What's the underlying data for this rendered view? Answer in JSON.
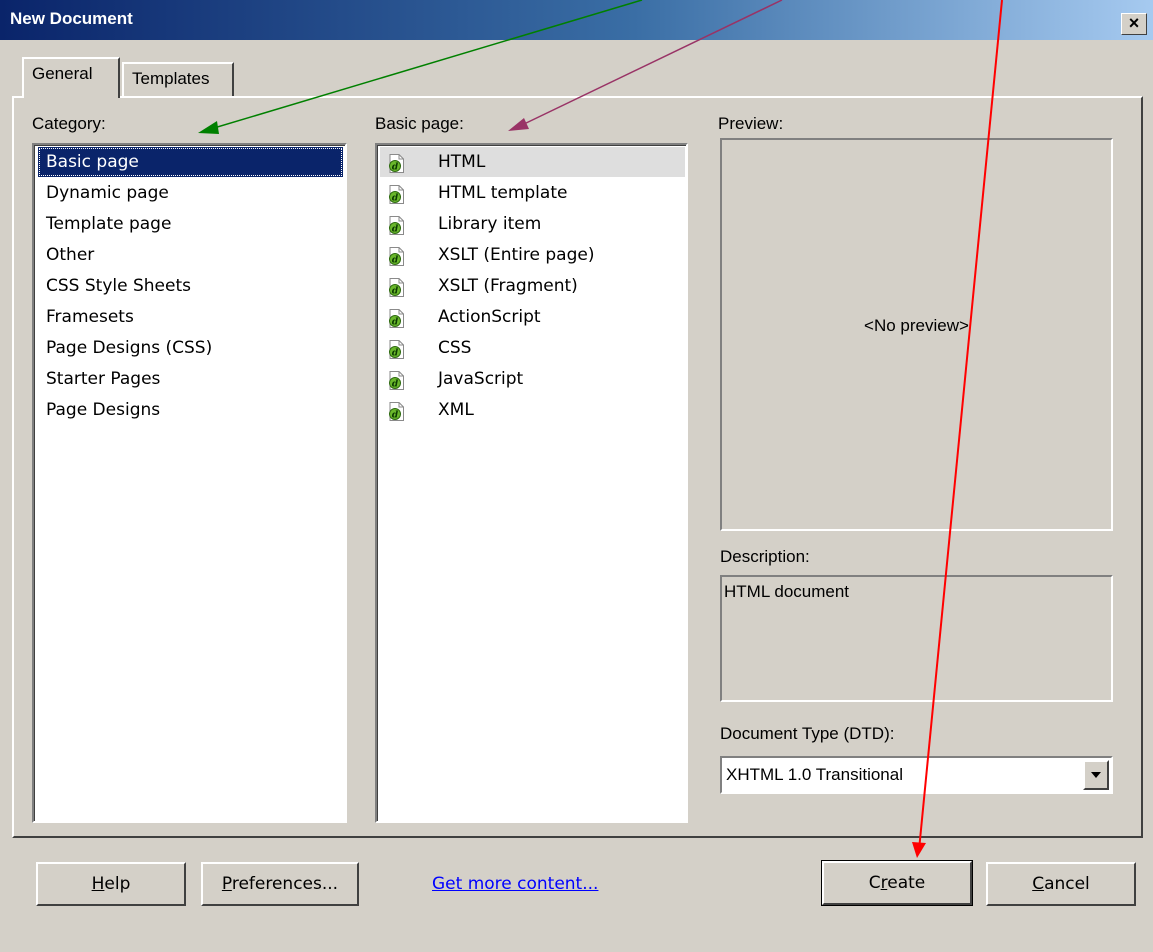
{
  "window": {
    "title": "New Document",
    "close_glyph": "×"
  },
  "tabs": [
    {
      "label": "General",
      "active": true
    },
    {
      "label": "Templates",
      "active": false
    }
  ],
  "category": {
    "label": "Category:",
    "items": [
      "Basic page",
      "Dynamic page",
      "Template page",
      "Other",
      "CSS Style Sheets",
      "Framesets",
      "Page Designs (CSS)",
      "Starter Pages",
      "Page Designs"
    ],
    "selected": "Basic page"
  },
  "type_list": {
    "label": "Basic page:",
    "items": [
      "HTML",
      "HTML template",
      "Library item",
      "XSLT (Entire page)",
      "XSLT (Fragment)",
      "ActionScript",
      "CSS",
      "JavaScript",
      "XML"
    ],
    "selected": "HTML",
    "item_icon": "dreamweaver-file-icon"
  },
  "preview": {
    "label": "Preview:",
    "text": "<No preview>"
  },
  "description": {
    "label": "Description:",
    "text": "HTML document"
  },
  "dtd": {
    "label": "Document Type (DTD):",
    "value": "XHTML 1.0 Transitional"
  },
  "buttons": {
    "help": {
      "label_pre": "",
      "mnemonic": "H",
      "label_post": "elp"
    },
    "preferences": {
      "label_pre": "",
      "mnemonic": "P",
      "label_post": "references..."
    },
    "create": {
      "label_pre": "C",
      "mnemonic": "r",
      "label_post": "eate"
    },
    "cancel": {
      "label_pre": "",
      "mnemonic": "C",
      "label_post": "ancel"
    }
  },
  "link": {
    "label": "Get more content..."
  },
  "colors": {
    "selection": "#0a246a",
    "dialog_bg": "#d4d0c8",
    "link": "#0000ff",
    "arrow_category": "#008000",
    "arrow_type": "#993366",
    "arrow_create": "#ff0000"
  }
}
